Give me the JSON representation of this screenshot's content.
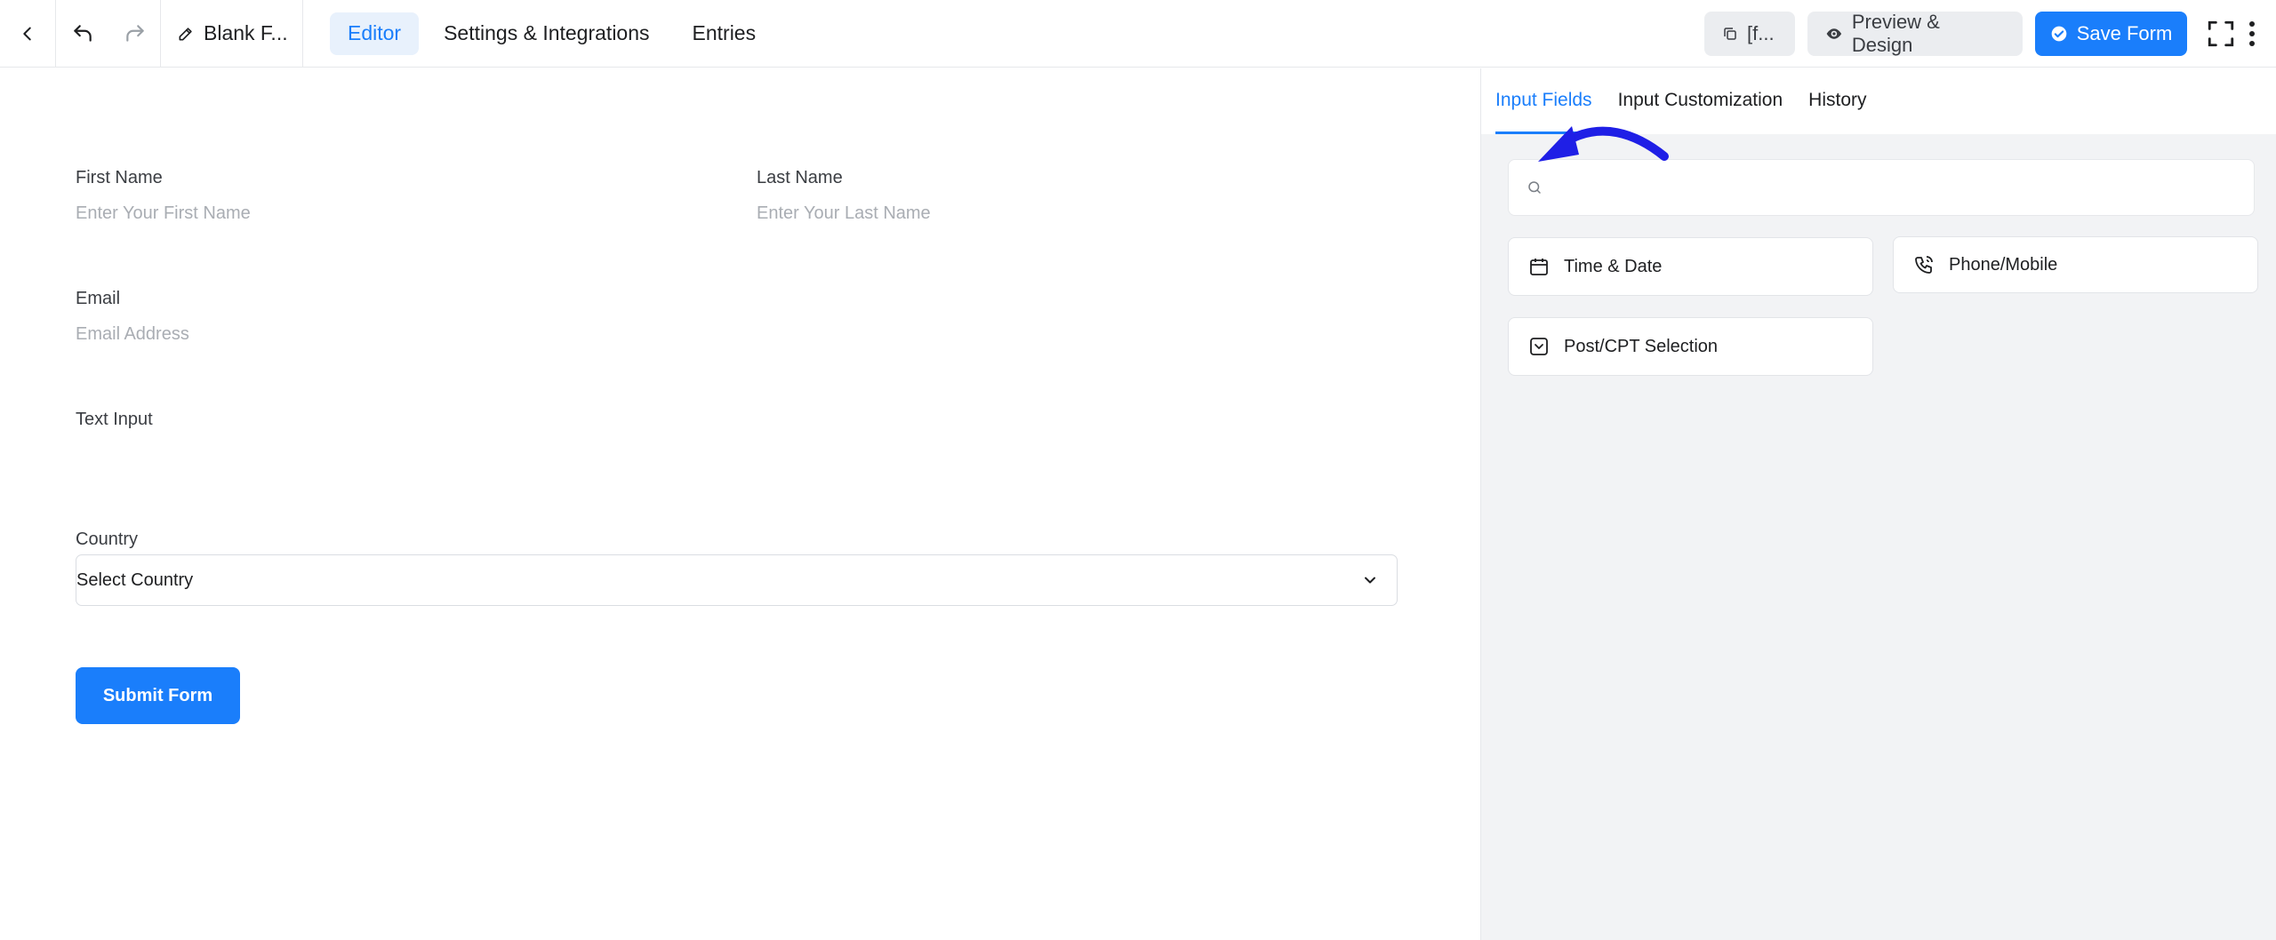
{
  "topbar": {
    "form_title": "Blank F...",
    "tabs": [
      {
        "label": "Editor",
        "active": true
      },
      {
        "label": "Settings & Integrations",
        "active": false
      },
      {
        "label": "Entries",
        "active": false
      }
    ],
    "shortcode_label": "[f...",
    "preview_label": "Preview & Design",
    "save_label": "Save Form"
  },
  "form": {
    "first_name": {
      "label": "First Name",
      "placeholder": "Enter Your First Name"
    },
    "last_name": {
      "label": "Last Name",
      "placeholder": "Enter Your Last Name"
    },
    "email": {
      "label": "Email",
      "placeholder": "Email Address"
    },
    "text_input": {
      "label": "Text Input"
    },
    "country": {
      "label": "Country",
      "value": "Select Country"
    },
    "submit_label": "Submit Form"
  },
  "panel": {
    "tabs": [
      {
        "label": "Input Fields",
        "active": true
      },
      {
        "label": "Input Customization",
        "active": false
      },
      {
        "label": "History",
        "active": false
      }
    ],
    "search_value": "",
    "fields": [
      {
        "label": "Time & Date",
        "icon": "calendar-icon"
      },
      {
        "label": "Phone/Mobile",
        "icon": "phone-icon"
      },
      {
        "label": "Post/CPT Selection",
        "icon": "dropdown-box-icon"
      }
    ]
  },
  "colors": {
    "accent": "#1a7efb",
    "annotation_arrow": "#1f1fe6"
  }
}
